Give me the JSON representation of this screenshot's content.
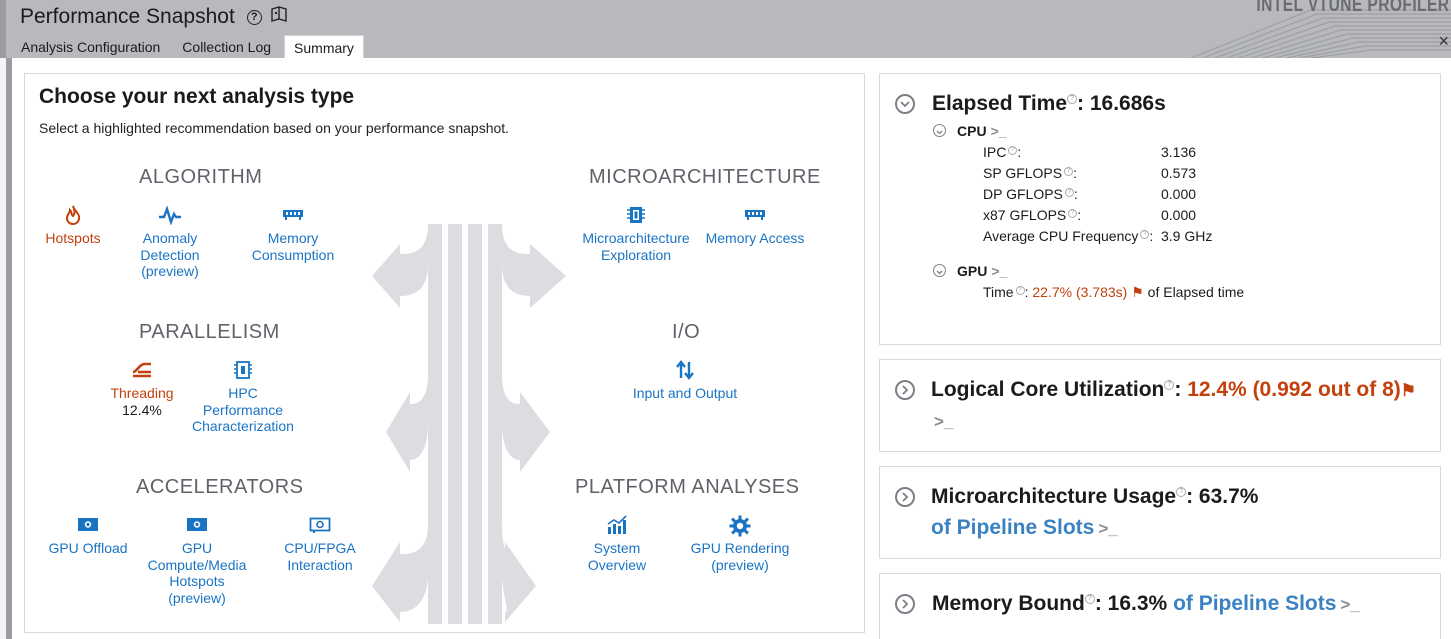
{
  "header": {
    "title": "Performance Snapshot",
    "brand": "INTEL VTUNE PROFILER",
    "tabs": [
      {
        "label": "Analysis Configuration",
        "active": false
      },
      {
        "label": "Collection Log",
        "active": false
      },
      {
        "label": "Summary",
        "active": true
      }
    ],
    "close": "×"
  },
  "chooser": {
    "heading": "Choose your next analysis type",
    "subtitle": "Select a highlighted recommendation based on your performance snapshot.",
    "categories": {
      "algorithm": "ALGORITHM",
      "microarchitecture": "MICROARCHITECTURE",
      "parallelism": "PARALLELISM",
      "io": "I/O",
      "accelerators": "ACCELERATORS",
      "platform": "PLATFORM ANALYSES"
    },
    "items": {
      "hotspots": {
        "l1": "Hotspots",
        "icon": "flame-icon"
      },
      "anomaly": {
        "l1": "Anomaly",
        "l2": "Detection",
        "l3": "(preview)",
        "icon": "pulse-icon"
      },
      "memory_consumption": {
        "l1": "Memory",
        "l2": "Consumption",
        "icon": "memory-chip-icon"
      },
      "uarch_exploration": {
        "l1": "Microarchitecture",
        "l2": "Exploration",
        "icon": "cpu-chip-icon"
      },
      "memory_access": {
        "l1": "Memory Access",
        "icon": "memory-chip-icon"
      },
      "threading": {
        "l1": "Threading",
        "value": "12.4%",
        "icon": "threads-icon"
      },
      "hpc": {
        "l1": "HPC",
        "l2": "Performance",
        "l3": "Characterization",
        "icon": "cpu-chip-icon"
      },
      "io": {
        "l1": "Input and Output",
        "icon": "updown-arrows-icon"
      },
      "gpu_offload": {
        "l1": "GPU Offload",
        "icon": "gpu-card-icon"
      },
      "gpu_compute": {
        "l1": "GPU",
        "l2": "Compute/Media",
        "l3": "Hotspots",
        "l4": "(preview)",
        "icon": "gpu-card-icon"
      },
      "cpu_fpga": {
        "l1": "CPU/FPGA",
        "l2": "Interaction",
        "icon": "fpga-card-icon"
      },
      "system_overview": {
        "l1": "System",
        "l2": "Overview",
        "icon": "bar-chart-icon"
      },
      "gpu_rendering": {
        "l1": "GPU Rendering",
        "l2": "(preview)",
        "icon": "gear-icon"
      }
    }
  },
  "elapsed": {
    "label": "Elapsed Time",
    "value": "16.686s",
    "cpu": {
      "label": "CPU",
      "rows": [
        {
          "name": "IPC",
          "value": "3.136"
        },
        {
          "name": "SP GFLOPS",
          "value": "0.573"
        },
        {
          "name": "DP GFLOPS",
          "value": "0.000"
        },
        {
          "name": "x87 GFLOPS",
          "value": "0.000"
        },
        {
          "name": "Average CPU Frequency",
          "value": "3.9 GHz"
        }
      ]
    },
    "gpu": {
      "label": "GPU",
      "time_label": "Time",
      "time_value": "22.7% (3.783s)",
      "time_suffix": "of Elapsed time"
    }
  },
  "logical_core": {
    "label": "Logical Core Utilization",
    "value": "12.4% (0.992 out of 8)"
  },
  "uarch_usage": {
    "label": "Microarchitecture Usage",
    "value": "63.7%",
    "suffix": "of Pipeline Slots"
  },
  "memory_bound": {
    "label": "Memory Bound",
    "value": "16.3%",
    "suffix": "of Pipeline Slots"
  },
  "colors": {
    "link": "#1a74c4",
    "warning": "#c2410c",
    "header_bg": "#b7b9bd"
  }
}
